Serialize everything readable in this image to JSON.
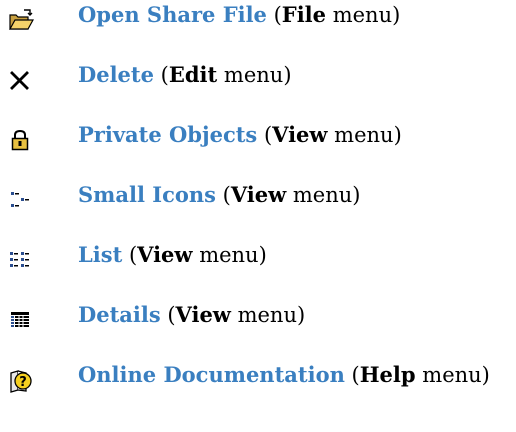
{
  "colors": {
    "link": "#3a7fc0",
    "text": "#000000",
    "background": "#ffffff"
  },
  "items": [
    {
      "icon": "open-folder-icon",
      "command": "Open Share File",
      "menu": "File",
      "suffix": "menu"
    },
    {
      "icon": "delete-x-icon",
      "command": "Delete",
      "menu": "Edit",
      "suffix": "menu"
    },
    {
      "icon": "padlock-icon",
      "command": "Private Objects",
      "menu": "View",
      "suffix": "menu"
    },
    {
      "icon": "small-icons-view-icon",
      "command": "Small Icons",
      "menu": "View",
      "suffix": "menu"
    },
    {
      "icon": "list-view-icon",
      "command": "List",
      "menu": "View",
      "suffix": "menu"
    },
    {
      "icon": "details-view-icon",
      "command": "Details",
      "menu": "View",
      "suffix": "menu"
    },
    {
      "icon": "help-question-icon",
      "command": "Online Documentation",
      "menu": "Help",
      "suffix": "menu"
    }
  ]
}
